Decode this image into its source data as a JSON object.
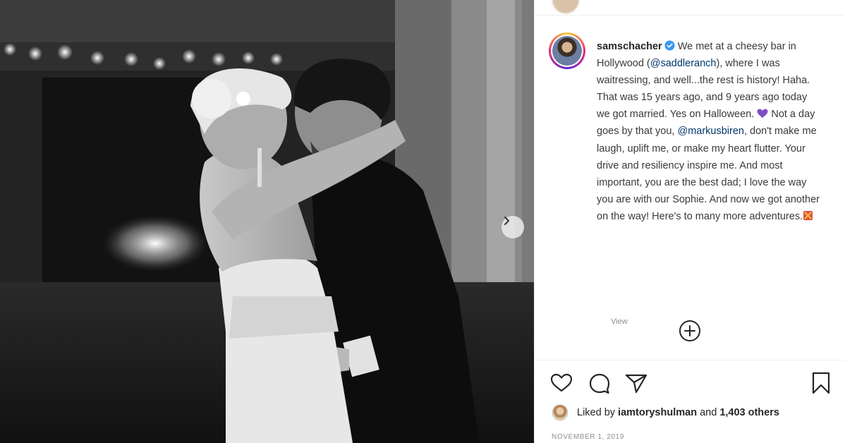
{
  "post": {
    "username": "samschacher",
    "caption": {
      "p1": "We met at a cheesy bar in Hollywood (",
      "mention1": "@saddleranch",
      "p2": "), where I was waitressing, and well...the rest is history! Haha. That was 15 years ago, and 9 years ago today we got married. Yes on Halloween.",
      "p3": "Not a day goes by that you, ",
      "mention2": "@markusbiren",
      "p4": ", don't make me laugh, uplift me, or make my heart flutter. Your drive and resiliency inspire me. And most important, you are the best dad; I love the way you are with our Sophie. And now we got another on the way! Here's to many more adventures."
    },
    "time_label": "View",
    "liked_by_prefix": "Liked by",
    "liked_by_user": "iamtoryshulman",
    "liked_by_and": "and",
    "liked_by_others": "1,403 others",
    "date": "NOVEMBER 1, 2019"
  },
  "icons": {
    "verified": "verified-badge-icon",
    "heart_emoji": "purple-heart-emoji-icon",
    "end_emoji": "emoji-icon",
    "next": "chevron-right-icon",
    "load_more": "plus-circle-icon",
    "like": "heart-icon",
    "comment": "comment-icon",
    "share": "paper-plane-icon",
    "save": "bookmark-icon"
  },
  "colors": {
    "verified": "#3897f0",
    "mention": "#00376b",
    "purple_heart": "#7d4fc4",
    "muted": "#8e8e8e"
  }
}
